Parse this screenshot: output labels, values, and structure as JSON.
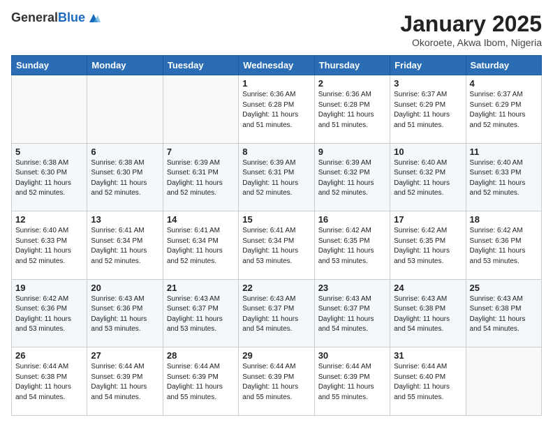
{
  "logo": {
    "general": "General",
    "blue": "Blue"
  },
  "title": "January 2025",
  "location": "Okoroete, Akwa Ibom, Nigeria",
  "days_of_week": [
    "Sunday",
    "Monday",
    "Tuesday",
    "Wednesday",
    "Thursday",
    "Friday",
    "Saturday"
  ],
  "weeks": [
    [
      {
        "day": "",
        "info": ""
      },
      {
        "day": "",
        "info": ""
      },
      {
        "day": "",
        "info": ""
      },
      {
        "day": "1",
        "info": "Sunrise: 6:36 AM\nSunset: 6:28 PM\nDaylight: 11 hours\nand 51 minutes."
      },
      {
        "day": "2",
        "info": "Sunrise: 6:36 AM\nSunset: 6:28 PM\nDaylight: 11 hours\nand 51 minutes."
      },
      {
        "day": "3",
        "info": "Sunrise: 6:37 AM\nSunset: 6:29 PM\nDaylight: 11 hours\nand 51 minutes."
      },
      {
        "day": "4",
        "info": "Sunrise: 6:37 AM\nSunset: 6:29 PM\nDaylight: 11 hours\nand 52 minutes."
      }
    ],
    [
      {
        "day": "5",
        "info": "Sunrise: 6:38 AM\nSunset: 6:30 PM\nDaylight: 11 hours\nand 52 minutes."
      },
      {
        "day": "6",
        "info": "Sunrise: 6:38 AM\nSunset: 6:30 PM\nDaylight: 11 hours\nand 52 minutes."
      },
      {
        "day": "7",
        "info": "Sunrise: 6:39 AM\nSunset: 6:31 PM\nDaylight: 11 hours\nand 52 minutes."
      },
      {
        "day": "8",
        "info": "Sunrise: 6:39 AM\nSunset: 6:31 PM\nDaylight: 11 hours\nand 52 minutes."
      },
      {
        "day": "9",
        "info": "Sunrise: 6:39 AM\nSunset: 6:32 PM\nDaylight: 11 hours\nand 52 minutes."
      },
      {
        "day": "10",
        "info": "Sunrise: 6:40 AM\nSunset: 6:32 PM\nDaylight: 11 hours\nand 52 minutes."
      },
      {
        "day": "11",
        "info": "Sunrise: 6:40 AM\nSunset: 6:33 PM\nDaylight: 11 hours\nand 52 minutes."
      }
    ],
    [
      {
        "day": "12",
        "info": "Sunrise: 6:40 AM\nSunset: 6:33 PM\nDaylight: 11 hours\nand 52 minutes."
      },
      {
        "day": "13",
        "info": "Sunrise: 6:41 AM\nSunset: 6:34 PM\nDaylight: 11 hours\nand 52 minutes."
      },
      {
        "day": "14",
        "info": "Sunrise: 6:41 AM\nSunset: 6:34 PM\nDaylight: 11 hours\nand 52 minutes."
      },
      {
        "day": "15",
        "info": "Sunrise: 6:41 AM\nSunset: 6:34 PM\nDaylight: 11 hours\nand 53 minutes."
      },
      {
        "day": "16",
        "info": "Sunrise: 6:42 AM\nSunset: 6:35 PM\nDaylight: 11 hours\nand 53 minutes."
      },
      {
        "day": "17",
        "info": "Sunrise: 6:42 AM\nSunset: 6:35 PM\nDaylight: 11 hours\nand 53 minutes."
      },
      {
        "day": "18",
        "info": "Sunrise: 6:42 AM\nSunset: 6:36 PM\nDaylight: 11 hours\nand 53 minutes."
      }
    ],
    [
      {
        "day": "19",
        "info": "Sunrise: 6:42 AM\nSunset: 6:36 PM\nDaylight: 11 hours\nand 53 minutes."
      },
      {
        "day": "20",
        "info": "Sunrise: 6:43 AM\nSunset: 6:36 PM\nDaylight: 11 hours\nand 53 minutes."
      },
      {
        "day": "21",
        "info": "Sunrise: 6:43 AM\nSunset: 6:37 PM\nDaylight: 11 hours\nand 53 minutes."
      },
      {
        "day": "22",
        "info": "Sunrise: 6:43 AM\nSunset: 6:37 PM\nDaylight: 11 hours\nand 54 minutes."
      },
      {
        "day": "23",
        "info": "Sunrise: 6:43 AM\nSunset: 6:37 PM\nDaylight: 11 hours\nand 54 minutes."
      },
      {
        "day": "24",
        "info": "Sunrise: 6:43 AM\nSunset: 6:38 PM\nDaylight: 11 hours\nand 54 minutes."
      },
      {
        "day": "25",
        "info": "Sunrise: 6:43 AM\nSunset: 6:38 PM\nDaylight: 11 hours\nand 54 minutes."
      }
    ],
    [
      {
        "day": "26",
        "info": "Sunrise: 6:44 AM\nSunset: 6:38 PM\nDaylight: 11 hours\nand 54 minutes."
      },
      {
        "day": "27",
        "info": "Sunrise: 6:44 AM\nSunset: 6:39 PM\nDaylight: 11 hours\nand 54 minutes."
      },
      {
        "day": "28",
        "info": "Sunrise: 6:44 AM\nSunset: 6:39 PM\nDaylight: 11 hours\nand 55 minutes."
      },
      {
        "day": "29",
        "info": "Sunrise: 6:44 AM\nSunset: 6:39 PM\nDaylight: 11 hours\nand 55 minutes."
      },
      {
        "day": "30",
        "info": "Sunrise: 6:44 AM\nSunset: 6:39 PM\nDaylight: 11 hours\nand 55 minutes."
      },
      {
        "day": "31",
        "info": "Sunrise: 6:44 AM\nSunset: 6:40 PM\nDaylight: 11 hours\nand 55 minutes."
      },
      {
        "day": "",
        "info": ""
      }
    ]
  ]
}
